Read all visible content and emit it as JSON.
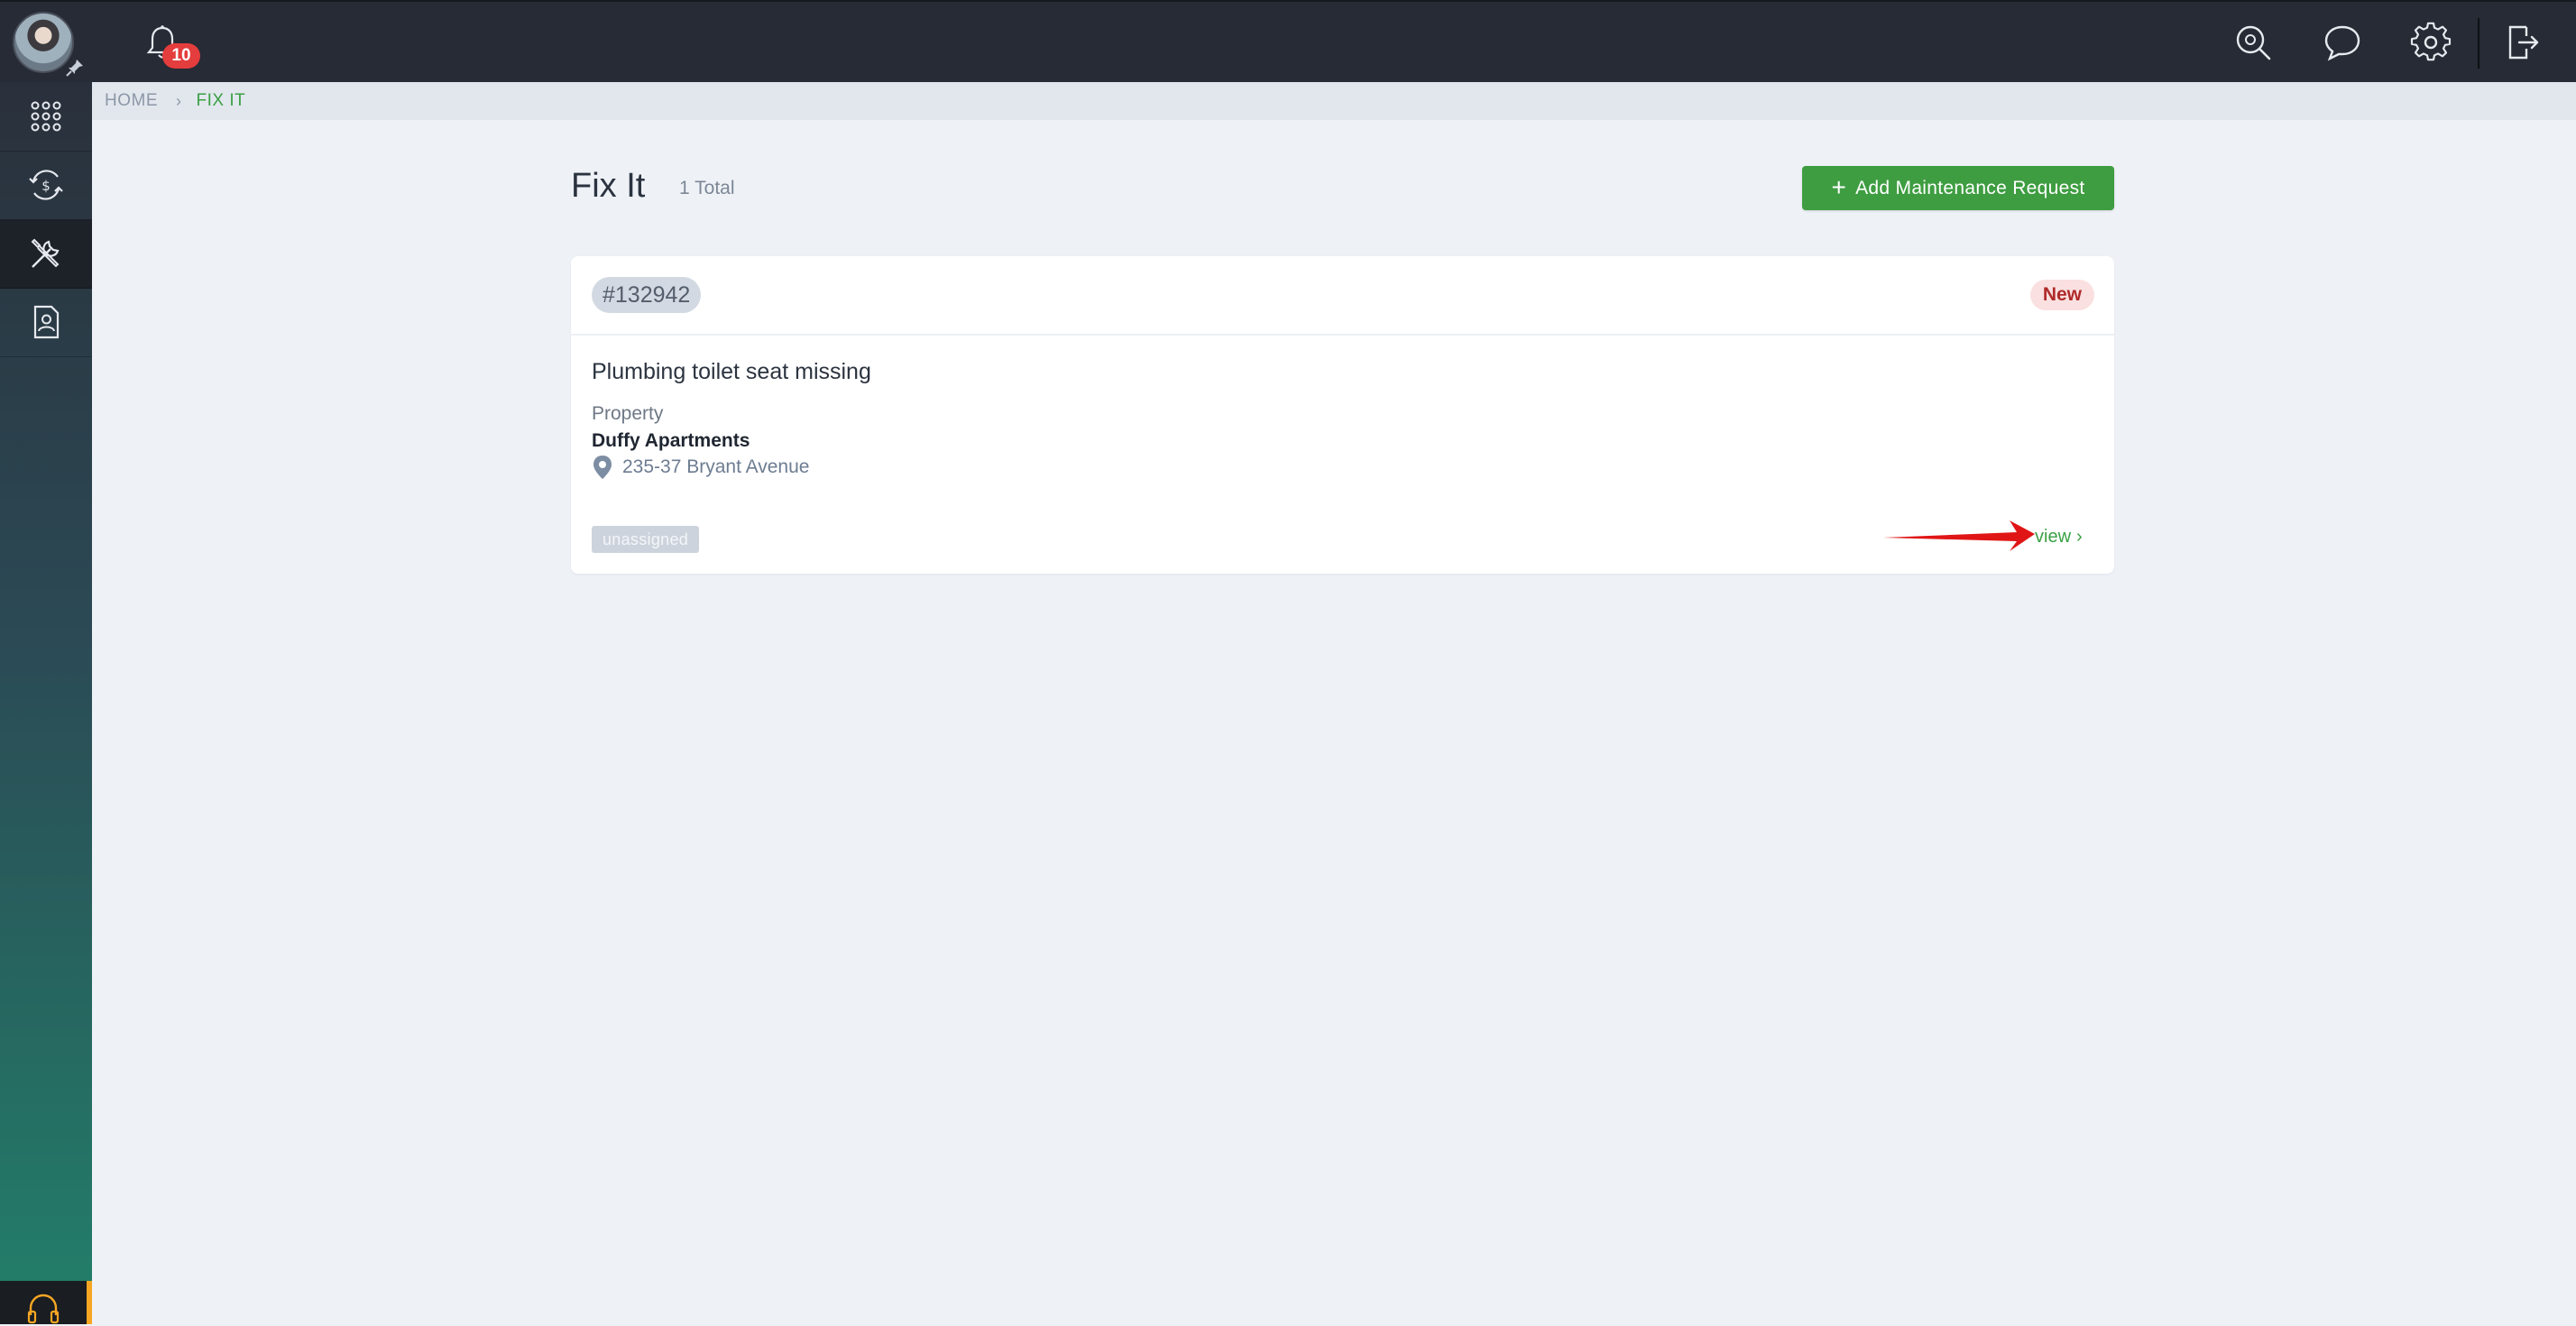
{
  "header": {
    "notifications_count": "10"
  },
  "breadcrumb": {
    "home": "HOME",
    "separator": "›",
    "current": "FIX IT"
  },
  "page": {
    "title": "Fix It",
    "total": "1 Total",
    "add_button": "Add Maintenance Request",
    "add_button_icon": "+"
  },
  "request": {
    "id": "#132942",
    "status": "New",
    "title": "Plumbing toilet seat missing",
    "property_label": "Property",
    "property_name": "Duffy Apartments",
    "address": "235-37 Bryant Avenue",
    "assignment": "unassigned",
    "view_label": "view",
    "view_chevron": "›"
  },
  "colors": {
    "accent_green": "#3e9d41",
    "topbar": "#262b35",
    "status_new_bg": "#fae0e0",
    "annotation_arrow": "#e01515"
  },
  "icons": {
    "sidebar": [
      "apps-grid-icon",
      "dollar-cycle-icon",
      "tools-icon",
      "document-user-icon"
    ],
    "topbar": [
      "search-icon",
      "chat-icon",
      "gear-icon",
      "logout-icon"
    ]
  }
}
